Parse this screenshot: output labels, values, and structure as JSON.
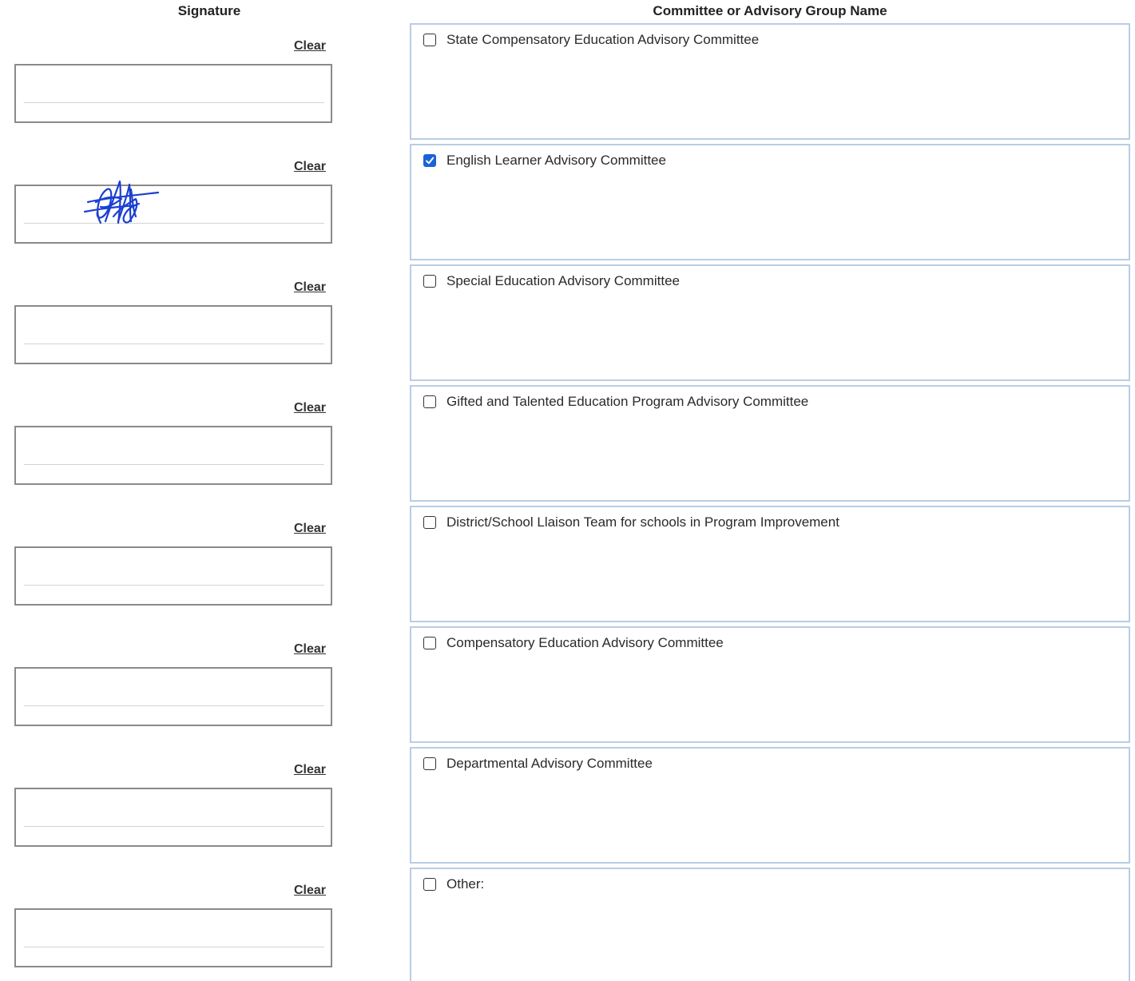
{
  "headers": {
    "signature": "Signature",
    "committee": "Committee or Advisory Group Name"
  },
  "colors": {
    "signature_ink": "#1b3fd1",
    "checkbox_checked": "#1a63d6",
    "committee_border": "#b9cde4"
  },
  "clear_label": "Clear",
  "rows": [
    {
      "committee": "State Compensatory Education Advisory Committee",
      "checked": false,
      "signed": false
    },
    {
      "committee": "English Learner Advisory Committee",
      "checked": true,
      "signed": true
    },
    {
      "committee": "Special Education Advisory Committee",
      "checked": false,
      "signed": false
    },
    {
      "committee": "Gifted and Talented Education Program Advisory Committee",
      "checked": false,
      "signed": false
    },
    {
      "committee": "District/School Llaison Team for schools in Program Improvement",
      "checked": false,
      "signed": false
    },
    {
      "committee": "Compensatory Education Advisory Committee",
      "checked": false,
      "signed": false
    },
    {
      "committee": "Departmental Advisory Committee",
      "checked": false,
      "signed": false
    },
    {
      "committee": "Other:",
      "checked": false,
      "signed": false
    }
  ]
}
